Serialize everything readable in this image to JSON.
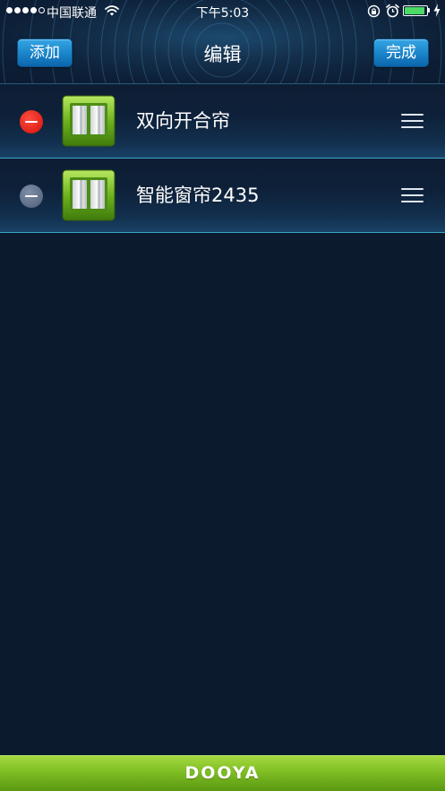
{
  "status_bar": {
    "carrier": "中国联通",
    "time": "下午5:03",
    "battery_level": 0.9
  },
  "nav": {
    "left_button": "添加",
    "title": "编辑",
    "right_button": "完成"
  },
  "devices": [
    {
      "name": "双向开合帘",
      "delete_state": "active"
    },
    {
      "name": "智能窗帘2435",
      "delete_state": "inactive"
    }
  ],
  "footer": {
    "brand": "DOOYA"
  },
  "colors": {
    "background": "#0c1a2e",
    "nav_button": "#1c86cb",
    "delete_active": "#e0231a",
    "delete_inactive": "#5d6c86",
    "footer_green": "#7fbe24",
    "row_divider": "#3aa6c4"
  },
  "icons": {
    "signal": "signal-dots-icon",
    "wifi": "wifi-icon",
    "rotation_lock": "rotation-lock-icon",
    "alarm": "alarm-clock-icon",
    "battery": "battery-icon",
    "charging": "charging-bolt-icon",
    "delete": "minus-circle-icon",
    "device": "curtain-icon",
    "reorder": "reorder-handle-icon"
  }
}
